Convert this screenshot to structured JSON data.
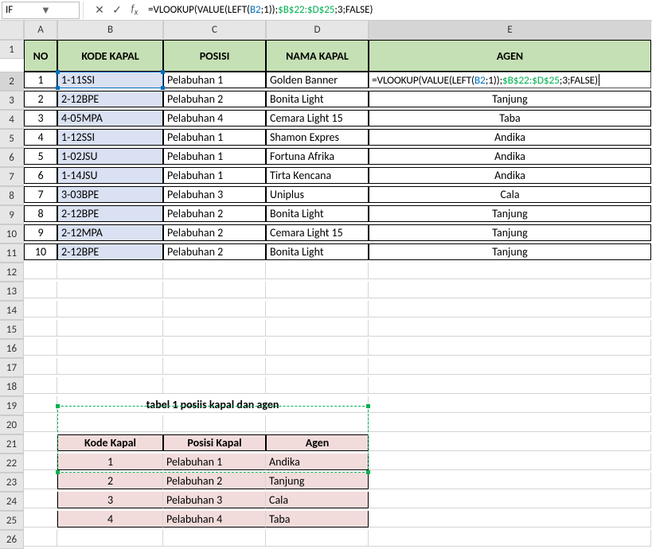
{
  "nameBox": "IF",
  "formulaBar": {
    "prefix": "=VLOOKUP(VALUE(LEFT(",
    "ref1": "B2",
    "mid1": ";",
    "one": "1",
    "mid2": "));",
    "range": "$B$22:$D$25",
    "mid3": ";",
    "three": "3",
    "mid4": ";FALSE)"
  },
  "columns": [
    "A",
    "B",
    "C",
    "D",
    "E"
  ],
  "rowCount": 26,
  "headers": {
    "no": "NO",
    "kode": "KODE KAPAL",
    "posisi": "POSISI",
    "nama": "NAMA KAPAL",
    "agen": "AGEN"
  },
  "rows": [
    {
      "no": "1",
      "kode": "1-11SSI",
      "posisi": "Pelabuhan 1",
      "nama": "Golden Banner",
      "agen_formula": true
    },
    {
      "no": "2",
      "kode": "2-12BPE",
      "posisi": "Pelabuhan 2",
      "nama": "Bonita Light",
      "agen": "Tanjung"
    },
    {
      "no": "3",
      "kode": "4-05MPA",
      "posisi": "Pelabuhan 4",
      "nama": "Cemara Light 15",
      "agen": "Taba"
    },
    {
      "no": "4",
      "kode": "1-12SSI",
      "posisi": "Pelabuhan 1",
      "nama": "Shamon Expres",
      "agen": "Andika"
    },
    {
      "no": "5",
      "kode": "1-02JSU",
      "posisi": "Pelabuhan 1",
      "nama": "Fortuna Afrika",
      "agen": "Andika"
    },
    {
      "no": "6",
      "kode": "1-14JSU",
      "posisi": "Pelabuhan 1",
      "nama": "Tirta Kencana",
      "agen": "Andika"
    },
    {
      "no": "7",
      "kode": "3-03BPE",
      "posisi": "Pelabuhan 3",
      "nama": "Uniplus",
      "agen": "Cala"
    },
    {
      "no": "8",
      "kode": "2-12BPE",
      "posisi": "Pelabuhan 2",
      "nama": "Bonita Light",
      "agen": "Tanjung"
    },
    {
      "no": "9",
      "kode": "2-12MPA",
      "posisi": "Pelabuhan 2",
      "nama": "Cemara Light 15",
      "agen": "Tanjung"
    },
    {
      "no": "10",
      "kode": "2-12BPE",
      "posisi": "Pelabuhan 2",
      "nama": "Bonita Light",
      "agen": "Tanjung"
    }
  ],
  "table2Title": "tabel 1 posiis kapal dan agen",
  "table2Headers": {
    "kode": "Kode Kapal",
    "posisi": "Posisi Kapal",
    "agen": "Agen"
  },
  "table2Rows": [
    {
      "kode": "1",
      "posisi": "Pelabuhan 1",
      "agen": "Andika"
    },
    {
      "kode": "2",
      "posisi": "Pelabuhan 2",
      "agen": "Tanjung"
    },
    {
      "kode": "3",
      "posisi": "Pelabuhan 3",
      "agen": "Cala"
    },
    {
      "kode": "4",
      "posisi": "Pelabuhan 4",
      "agen": "Taba"
    }
  ],
  "icons": {
    "cancel": "✕",
    "accept": "✓",
    "dropdown": "▼"
  }
}
